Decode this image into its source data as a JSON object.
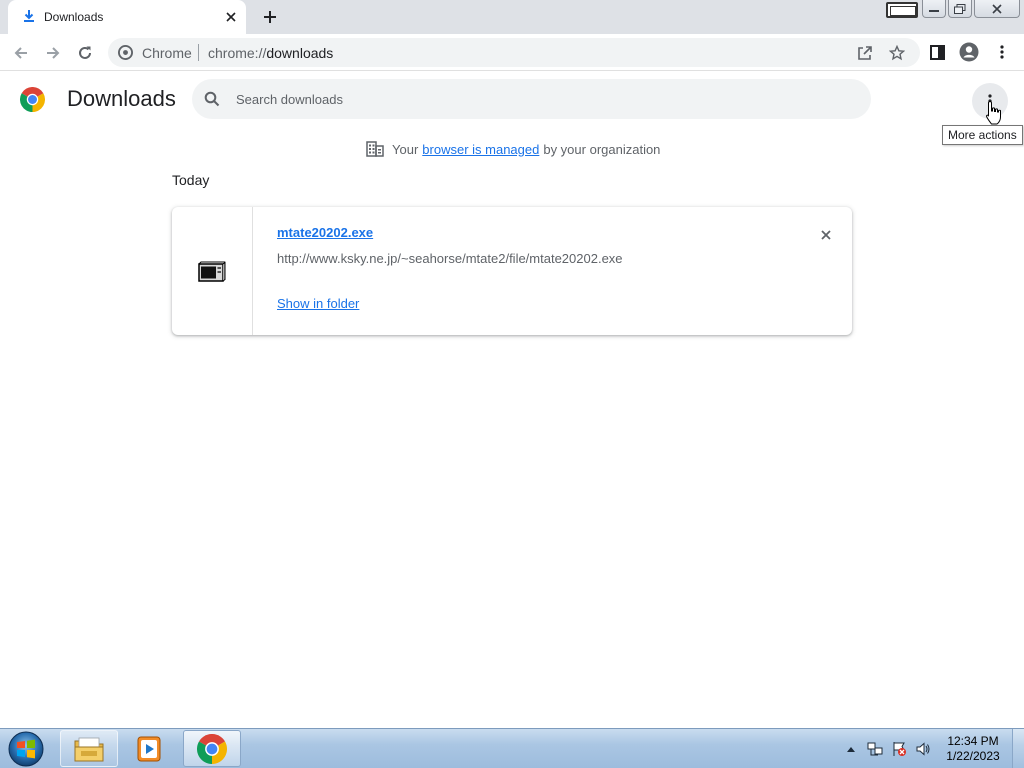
{
  "browser": {
    "tab": {
      "title": "Downloads"
    },
    "omnibox": {
      "origin_chip": "Chrome",
      "url_scheme": "chrome://",
      "url_path": "downloads"
    }
  },
  "page": {
    "title": "Downloads",
    "search": {
      "placeholder": "Search downloads",
      "value": ""
    },
    "tooltip": "More actions",
    "managed_notice": {
      "prefix": "Your",
      "link": "browser is managed",
      "suffix": "by your organization"
    }
  },
  "downloads": {
    "date_header": "Today",
    "items": [
      {
        "file_name": "mtate20202.exe",
        "url": "http://www.ksky.ne.jp/~seahorse/mtate2/file/mtate20202.exe",
        "action": "Show in folder"
      }
    ]
  },
  "taskbar": {
    "clock": {
      "time": "12:34 PM",
      "date": "1/22/2023"
    }
  },
  "colors": {
    "link": "#1a73e8",
    "tabstrip": "#dee1e6",
    "omnibox": "#f1f3f4",
    "muted_text": "#5f6368"
  },
  "icons": [
    "download-icon",
    "close-icon",
    "plus-icon",
    "back-icon",
    "forward-icon",
    "reload-icon",
    "chrome-icon",
    "share-icon",
    "star-icon",
    "side-panel-icon",
    "profile-icon",
    "kebab-menu-icon",
    "search-icon",
    "building-icon",
    "exe-file-icon",
    "windows-start-icon",
    "file-explorer-icon",
    "media-player-icon",
    "chrome-taskbar-icon",
    "network-icon",
    "action-center-icon",
    "volume-icon"
  ]
}
